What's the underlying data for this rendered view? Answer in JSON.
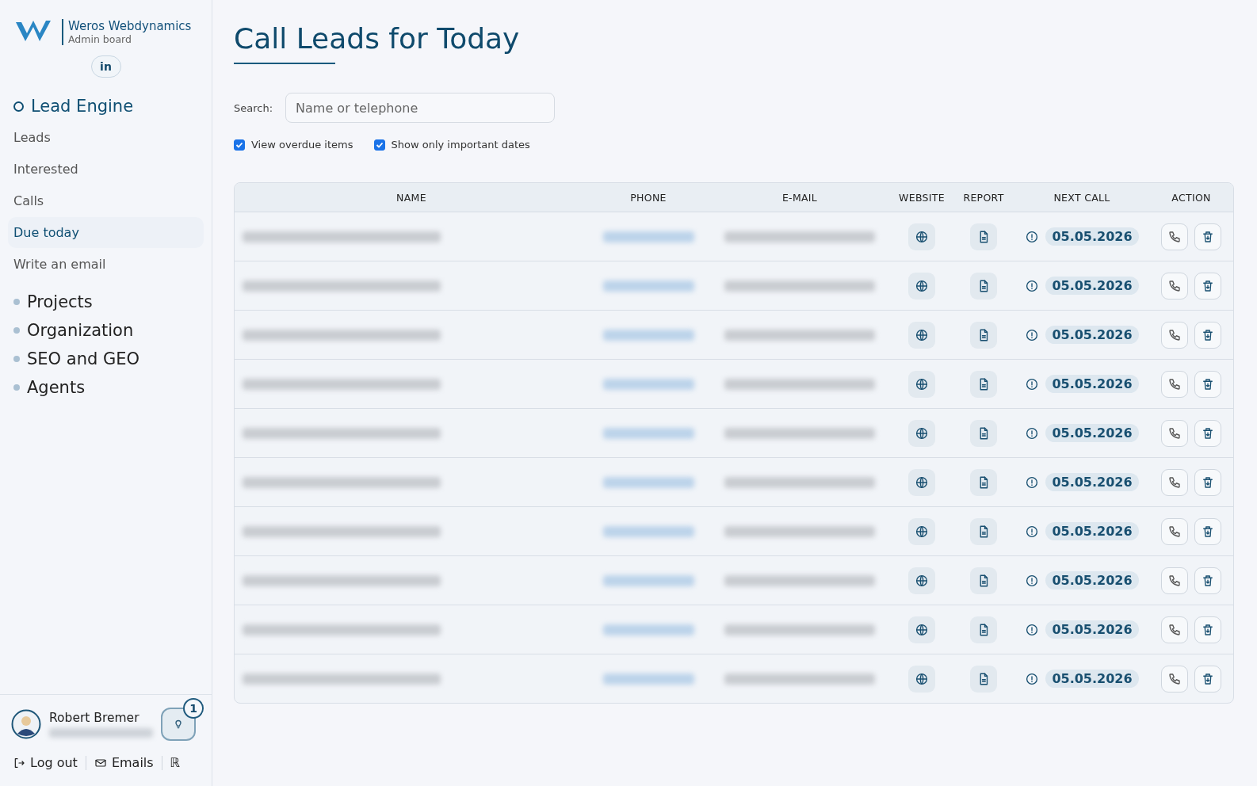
{
  "brand": {
    "name": "Weros Webdynamics",
    "subtitle": "Admin board",
    "social": "in"
  },
  "nav": [
    {
      "label": "Lead Engine",
      "expanded": true,
      "children": [
        {
          "label": "Leads",
          "selected": false
        },
        {
          "label": "Interested",
          "selected": false
        },
        {
          "label": "Calls",
          "selected": false
        },
        {
          "label": "Due today",
          "selected": true
        },
        {
          "label": "Write an email",
          "selected": false
        }
      ]
    },
    {
      "label": "Projects",
      "expanded": false
    },
    {
      "label": "Organization",
      "expanded": false
    },
    {
      "label": "SEO and GEO",
      "expanded": false
    },
    {
      "label": "Agents",
      "expanded": false
    }
  ],
  "user": {
    "name": "Robert Bremer",
    "notifications": "1"
  },
  "footer_links": [
    {
      "kind": "logout",
      "label": "Log out"
    },
    {
      "kind": "emails",
      "label": "Emails"
    },
    {
      "kind": "glyph",
      "label": "ℝ"
    }
  ],
  "page_title": "Call Leads for Today",
  "search": {
    "label": "Search:",
    "placeholder": "Name or telephone"
  },
  "filters": [
    {
      "label": "View overdue items",
      "checked": true
    },
    {
      "label": "Show only important dates",
      "checked": true
    }
  ],
  "table": {
    "columns": [
      "NAME",
      "PHONE",
      "E-MAIL",
      "WEBSITE",
      "REPORT",
      "NEXT CALL",
      "ACTION"
    ],
    "rows": [
      {
        "next_call": "05.05.2026"
      },
      {
        "next_call": "05.05.2026"
      },
      {
        "next_call": "05.05.2026"
      },
      {
        "next_call": "05.05.2026"
      },
      {
        "next_call": "05.05.2026"
      },
      {
        "next_call": "05.05.2026"
      },
      {
        "next_call": "05.05.2026"
      },
      {
        "next_call": "05.05.2026"
      },
      {
        "next_call": "05.05.2026"
      },
      {
        "next_call": "05.05.2026"
      }
    ]
  }
}
